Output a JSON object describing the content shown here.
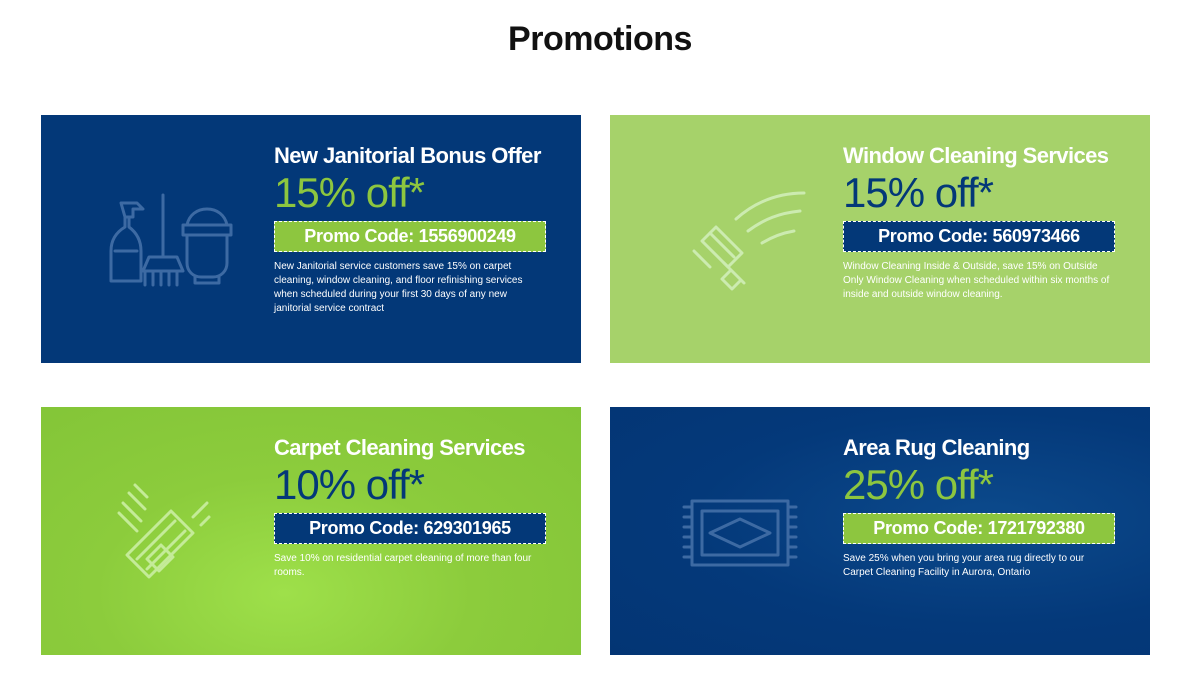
{
  "page": {
    "title": "Promotions"
  },
  "colors": {
    "navy": "#033878",
    "light_green": "#a6d26a",
    "bright_green": "#8ccc3c",
    "accent_green": "#8dc63f",
    "white": "#ffffff"
  },
  "promotions": [
    {
      "title": "New Janitorial Bonus Offer",
      "discount": "15% off*",
      "promo_code": "Promo Code: 1556900249",
      "description": "New Janitorial service customers save 15% on carpet cleaning, window cleaning, and floor refinishing services when scheduled during your first 30 days of any new janitorial service contract",
      "icon": "cleaning-supplies-icon"
    },
    {
      "title": "Window Cleaning Services",
      "discount": "15% off*",
      "promo_code": "Promo Code: 560973466",
      "description": "Window Cleaning Inside & Outside, save 15% on Outside Only Window Cleaning when scheduled within six months of inside and outside window cleaning.",
      "icon": "squeegee-icon"
    },
    {
      "title": "Carpet Cleaning Services",
      "discount": "10% off*",
      "promo_code": "Promo Code: 629301965",
      "description": "Save 10% on residential carpet cleaning of more than four rooms.",
      "icon": "carpet-brush-icon"
    },
    {
      "title": "Area Rug Cleaning",
      "discount": "25% off*",
      "promo_code": "Promo Code: 1721792380",
      "description": "Save 25% when you bring your area rug directly to our Carpet Cleaning Facility in Aurora, Ontario",
      "icon": "area-rug-icon"
    }
  ]
}
